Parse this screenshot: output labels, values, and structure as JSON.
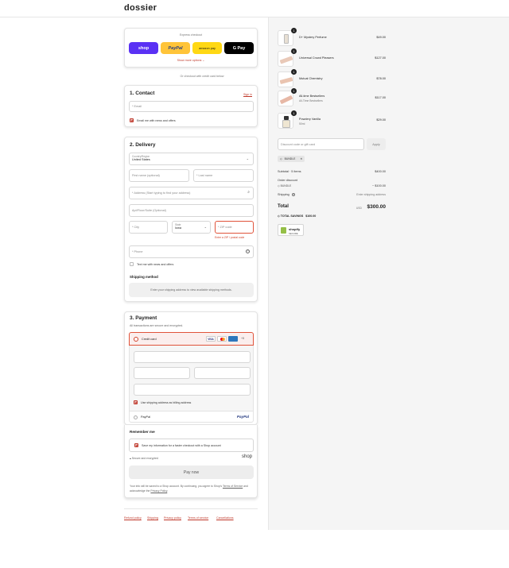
{
  "header": {
    "logo": "dossier"
  },
  "express": {
    "title": "Express checkout",
    "buttons": [
      {
        "label": "shop",
        "bg": "#5a31f4",
        "fg": "#ffffff"
      },
      {
        "label": "PayPal",
        "bg": "#ffc439",
        "fg": "#253b80"
      },
      {
        "label": "amazon pay",
        "bg": "#ffd814",
        "fg": "#111111"
      },
      {
        "label": "G Pay",
        "bg": "#000000",
        "fg": "#ffffff"
      }
    ],
    "more_options": "Show more options",
    "divider": "Or checkout with credit card below"
  },
  "contact": {
    "title": "1. Contact",
    "sign_in": "Sign in",
    "email_placeholder": "* Email",
    "news_label": "Email me with news and offers"
  },
  "delivery": {
    "title": "2. Delivery",
    "country_label": "Country/Region",
    "country_value": "United States",
    "first_name": "First name (optional)",
    "last_name": "* Last name",
    "address": "* Address (Start typing to find your address)",
    "apt": "Apt/Floor/Suite (Optional)",
    "city": "* City",
    "state_label": "State",
    "state_value": "Iowa",
    "zip": "* ZIP code",
    "zip_error": "Enter a ZIP / postal code",
    "phone": "* Phone",
    "text_label": "Text me with news and offers",
    "shipping_title": "Shipping method",
    "shipping_msg": "Enter your shipping address to view available shipping methods."
  },
  "payment": {
    "title": "3. Payment",
    "subtitle": "All transactions are secure and encrypted.",
    "credit_card": "Credit card",
    "card_more": "+5",
    "billing_label": "Use shipping address as billing address",
    "paypal_label": "PayPal",
    "paypal_logo": "PayPal"
  },
  "remember": {
    "title": "Remember me",
    "save_label": "Save my information for a faster checkout with a Shop account",
    "secure": "Secure and encrypted",
    "shop_logo": "shop",
    "pay_button": "Pay now",
    "legal_pre": "Your info will be saved to a Shop account. By continuing, you agree to Shop's ",
    "terms_link": "Terms of Service",
    "legal_mid": " and acknowledge the ",
    "privacy_link": "Privacy Policy",
    "legal_end": "."
  },
  "footer": {
    "links": [
      "Refund policy",
      "Shipping",
      "Privacy policy",
      "Terms of service",
      "Cancellations"
    ]
  },
  "order": {
    "items": [
      {
        "qty": "1",
        "name": "D+ Mystery Perfume",
        "sub": "",
        "price": "$49.00"
      },
      {
        "qty": "1",
        "name": "Universal Crowd Pleasers",
        "sub": "",
        "price": "$127.00"
      },
      {
        "qty": "1",
        "name": "Mutual Chemistry",
        "sub": "",
        "price": "$78.00"
      },
      {
        "qty": "1",
        "name": "All-time Bestsellers",
        "sub": "All-Time Bestsellers",
        "price": "$117.00"
      },
      {
        "qty": "1",
        "name": "Powdery Vanilla",
        "sub": "50ml",
        "price": "$29.00"
      }
    ],
    "discount_placeholder": "Discount code or gift card",
    "apply": "Apply",
    "tag": "BUNDLE",
    "subtotal_label": "Subtotal · 5 items",
    "subtotal_value": "$400.00",
    "order_discount": "Order discount",
    "discount_code": "BUNDLE",
    "discount_value": "− $100.00",
    "shipping_label": "Shipping",
    "shipping_value": "Enter shipping address",
    "total_label": "Total",
    "currency": "USD",
    "total_value": "$300.00",
    "savings_label": "TOTAL SAVINGS",
    "savings_value": "$100.00",
    "badge_title": "shopify",
    "badge_sub": "SECURE"
  }
}
